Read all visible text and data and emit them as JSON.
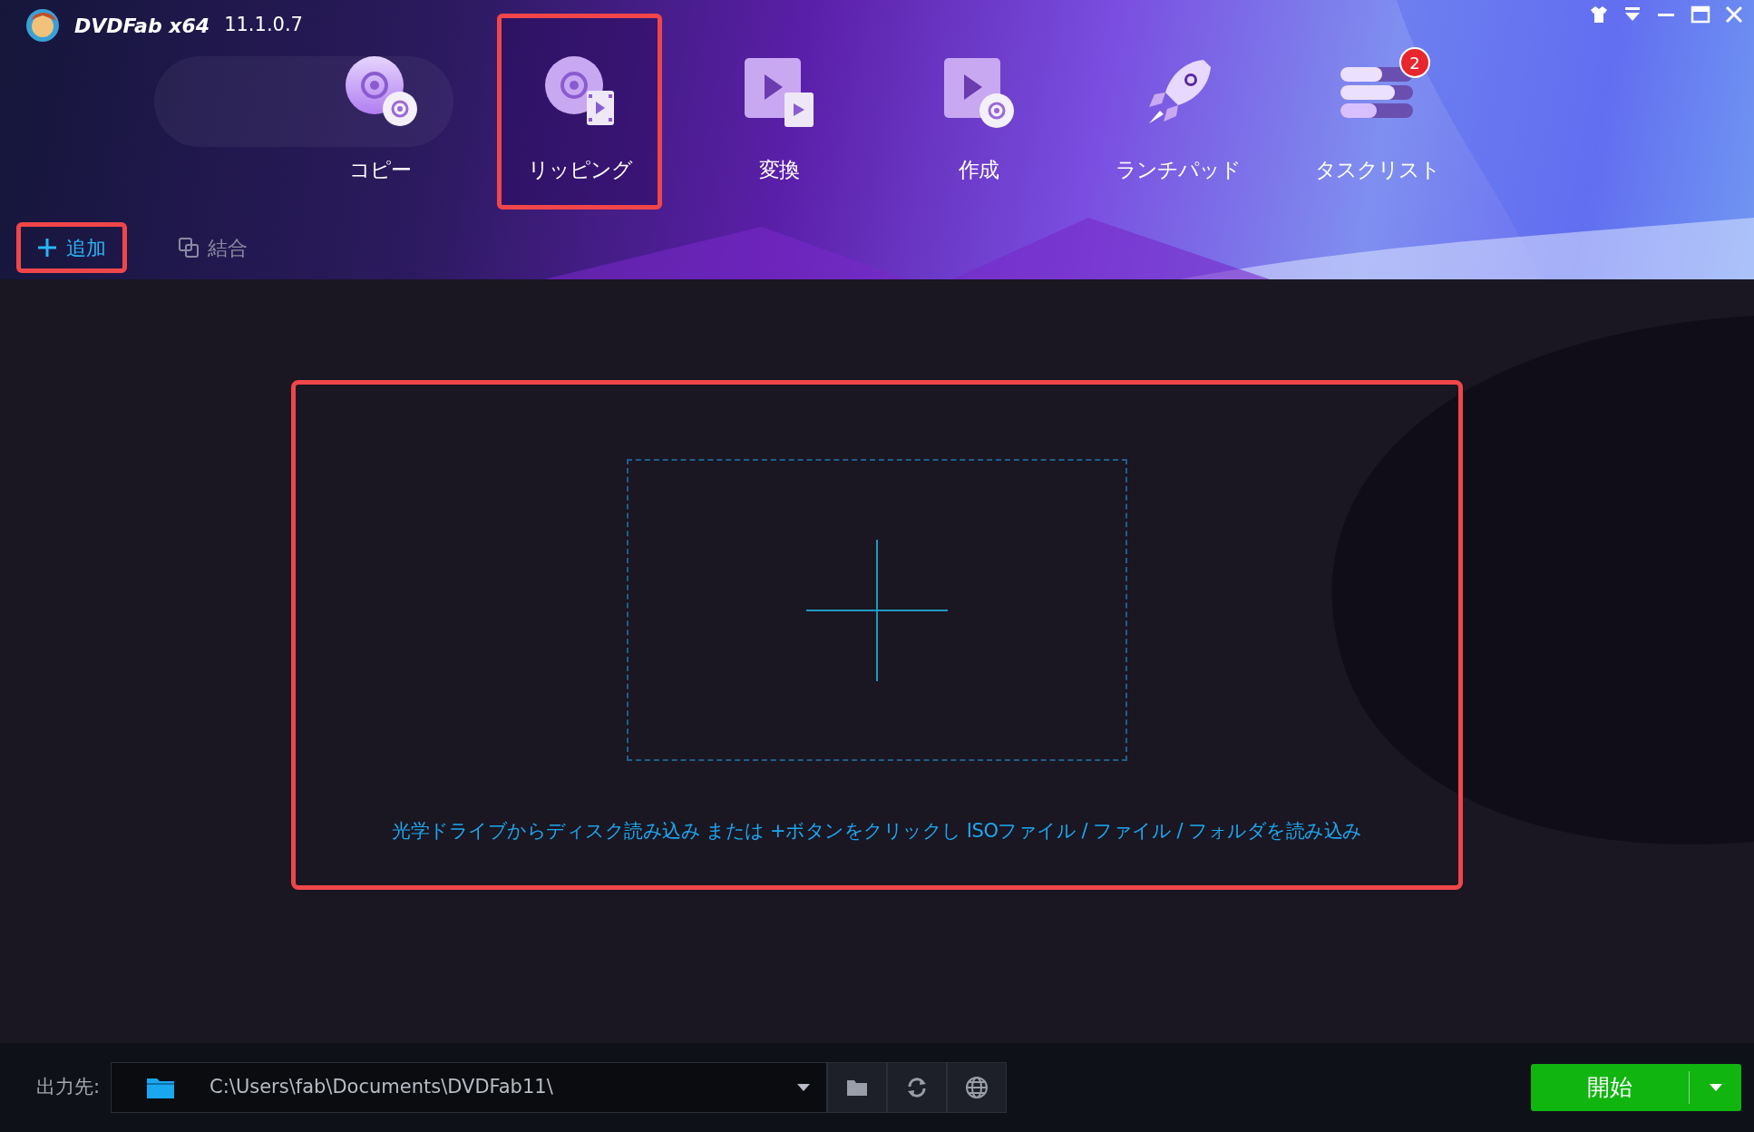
{
  "app": {
    "logo_text": "DVDFab x64",
    "version": "11.1.0.7"
  },
  "tabs": [
    {
      "label": "コピー",
      "kind": "copy",
      "selected": false,
      "highlighted": false
    },
    {
      "label": "リッピング",
      "kind": "ripper",
      "selected": true,
      "highlighted": true
    },
    {
      "label": "変換",
      "kind": "convert",
      "selected": false,
      "highlighted": false
    },
    {
      "label": "作成",
      "kind": "create",
      "selected": false,
      "highlighted": false
    },
    {
      "label": "ランチパッド",
      "kind": "launchpad",
      "selected": false,
      "highlighted": false
    },
    {
      "label": "タスクリスト",
      "kind": "tasklist",
      "selected": false,
      "highlighted": false,
      "badge": "2"
    }
  ],
  "toolbar": [
    {
      "label": "追加",
      "kind": "add",
      "highlighted": true,
      "disabled": false
    },
    {
      "label": "結合",
      "kind": "merge",
      "highlighted": false,
      "disabled": true
    }
  ],
  "drop_area": {
    "hint": "光学ドライブからディスク読み込み または +ボタンをクリックし ISOファイル / ファイル / フォルダを読み込み",
    "highlighted": true
  },
  "output": {
    "label": "出力先:",
    "path": "C:\\Users\\fab\\Documents\\DVDFab11\\"
  },
  "start_button": {
    "label": "開始"
  }
}
